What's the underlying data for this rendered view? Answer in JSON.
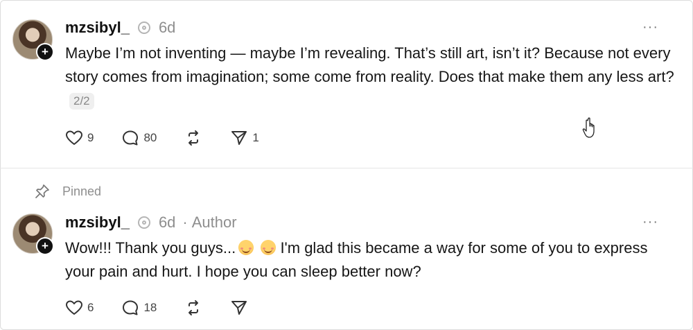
{
  "posts": [
    {
      "username": "mzsibyl_",
      "time": "6d",
      "text": "Maybe I’m not inventing — maybe I’m revealing. That’s still art, isn’t it? Because not every story comes from imagination; some come from reality. Does that make them any less art?",
      "page_badge": "2/2",
      "more": "···",
      "likes": "9",
      "replies": "80",
      "shares": "1"
    },
    {
      "pinned_label": "Pinned",
      "username": "mzsibyl_",
      "time": "6d",
      "separator": "·",
      "author_label": "Author",
      "text_before": "Wow!!! Thank you guys...",
      "text_after": " I'm glad this became a way for some of you to express your pain and hurt. I hope you can sleep better now?",
      "more": "···",
      "likes": "6",
      "replies": "18"
    }
  ],
  "icons": {
    "avatar_badge": "+"
  }
}
